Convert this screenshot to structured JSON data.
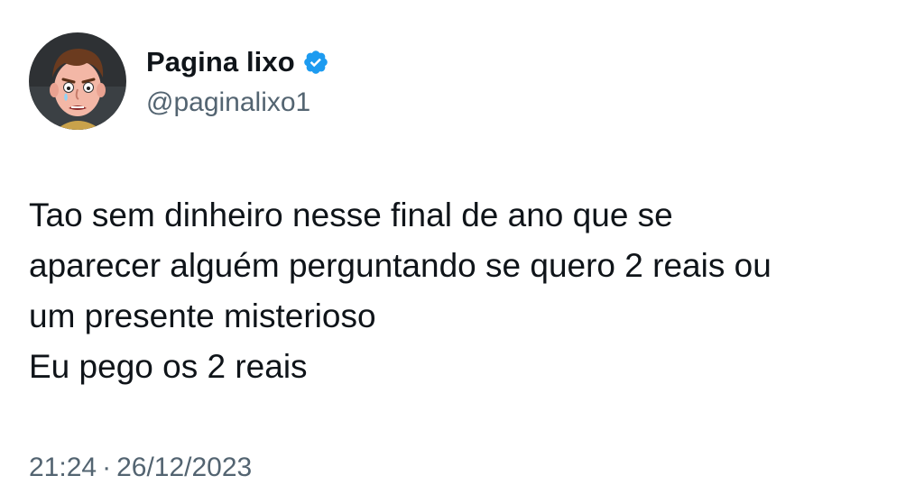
{
  "author": {
    "display_name": "Pagina lixo",
    "handle": "@paginalixo1",
    "verified": true,
    "avatar_icon": "cartoon-face-avatar",
    "verified_icon": "verified-badge-icon",
    "verified_color": "#1d9bf0"
  },
  "tweet": {
    "lines": [
      "Tao sem dinheiro nesse final de ano que se",
      "aparecer alguém perguntando se quero 2 reais ou",
      "um presente misterioso",
      "Eu pego os 2 reais"
    ]
  },
  "meta": {
    "time": "21:24",
    "separator": "·",
    "date": "26/12/2023"
  }
}
